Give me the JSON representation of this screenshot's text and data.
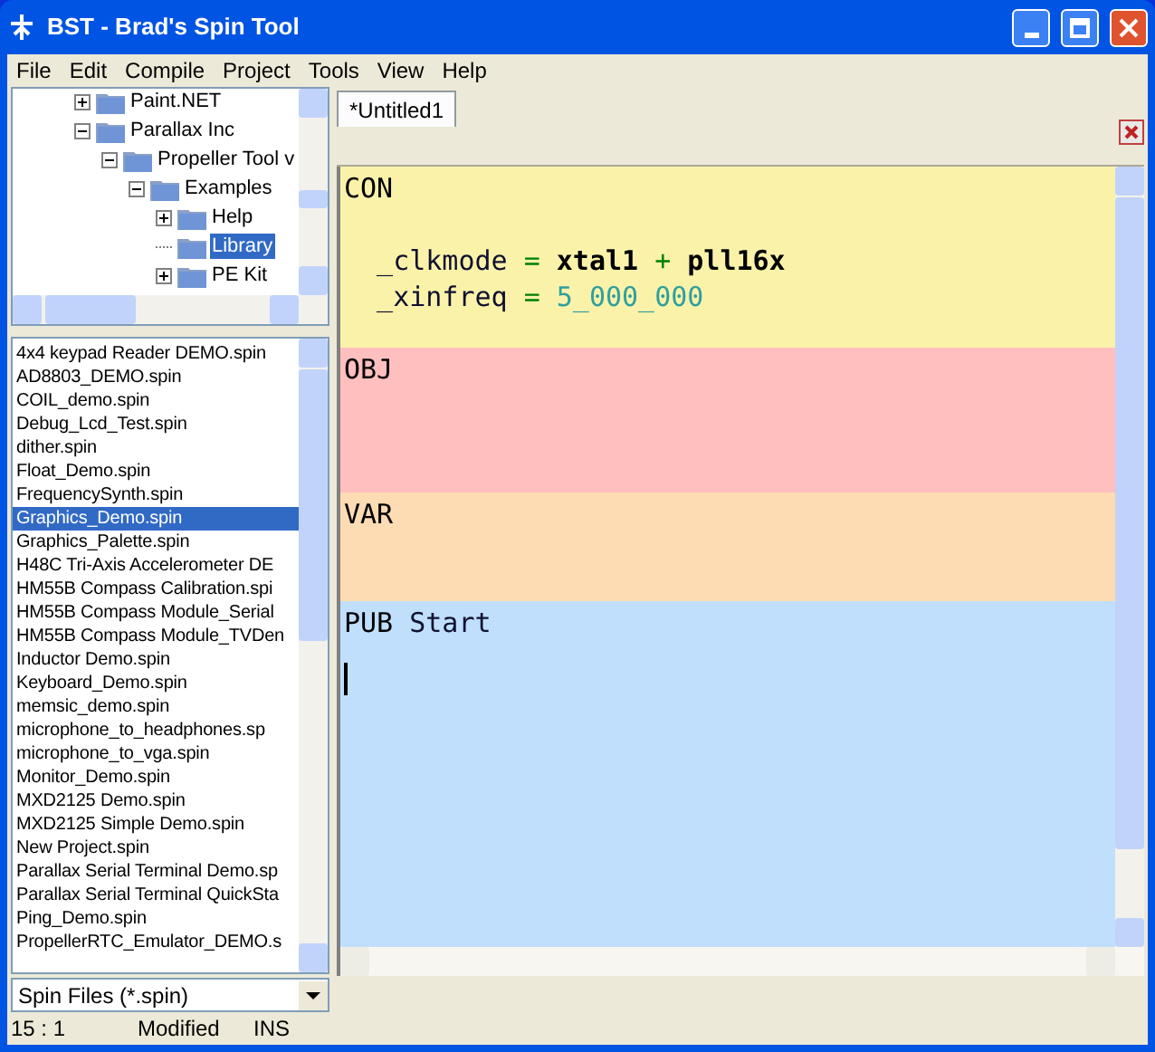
{
  "window": {
    "title": "BST - Brad's Spin Tool"
  },
  "menu": [
    "File",
    "Edit",
    "Compile",
    "Project",
    "Tools",
    "View",
    "Help"
  ],
  "tree": [
    {
      "label": "Paint.NET",
      "kind": "collapsed",
      "selected": false
    },
    {
      "label": "Parallax Inc",
      "kind": "expanded",
      "selected": false,
      "children": [
        {
          "label": "Propeller Tool v",
          "kind": "expanded",
          "selected": false,
          "children": [
            {
              "label": "Examples",
              "kind": "expanded",
              "selected": false,
              "children": [
                {
                  "label": "Help",
                  "kind": "collapsed",
                  "selected": false
                },
                {
                  "label": "Library",
                  "kind": "leaf",
                  "selected": true
                },
                {
                  "label": "PE Kit",
                  "kind": "collapsed",
                  "selected": false
                }
              ]
            }
          ]
        }
      ]
    }
  ],
  "files": [
    {
      "name": "4x4 keypad Reader DEMO.spin",
      "selected": false
    },
    {
      "name": "AD8803_DEMO.spin",
      "selected": false
    },
    {
      "name": "COIL_demo.spin",
      "selected": false
    },
    {
      "name": "Debug_Lcd_Test.spin",
      "selected": false
    },
    {
      "name": "dither.spin",
      "selected": false
    },
    {
      "name": "Float_Demo.spin",
      "selected": false
    },
    {
      "name": "FrequencySynth.spin",
      "selected": false
    },
    {
      "name": "Graphics_Demo.spin",
      "selected": true
    },
    {
      "name": "Graphics_Palette.spin",
      "selected": false
    },
    {
      "name": "H48C Tri-Axis Accelerometer DE",
      "selected": false
    },
    {
      "name": "HM55B Compass Calibration.spi",
      "selected": false
    },
    {
      "name": "HM55B Compass Module_Serial",
      "selected": false
    },
    {
      "name": "HM55B Compass Module_TVDen",
      "selected": false
    },
    {
      "name": "Inductor Demo.spin",
      "selected": false
    },
    {
      "name": "Keyboard_Demo.spin",
      "selected": false
    },
    {
      "name": "memsic_demo.spin",
      "selected": false
    },
    {
      "name": "microphone_to_headphones.sp",
      "selected": false
    },
    {
      "name": "microphone_to_vga.spin",
      "selected": false
    },
    {
      "name": "Monitor_Demo.spin",
      "selected": false
    },
    {
      "name": "MXD2125 Demo.spin",
      "selected": false
    },
    {
      "name": "MXD2125 Simple Demo.spin",
      "selected": false
    },
    {
      "name": "New Project.spin",
      "selected": false
    },
    {
      "name": "Parallax Serial Terminal Demo.sp",
      "selected": false
    },
    {
      "name": "Parallax Serial Terminal QuickSta",
      "selected": false
    },
    {
      "name": "Ping_Demo.spin",
      "selected": false
    },
    {
      "name": "PropellerRTC_Emulator_DEMO.s",
      "selected": false
    }
  ],
  "filter": {
    "value": "Spin Files (*.spin)"
  },
  "tabs": [
    {
      "label": "*Untitled1",
      "selected": true
    }
  ],
  "sections": [
    {
      "kind": "con",
      "caret": false,
      "lines": [
        [
          {
            "kind": "block",
            "text": "CON"
          }
        ],
        [
          {
            "kind": "ident",
            "text": "  _clkmode"
          },
          {
            "kind": "op",
            "text": " = "
          },
          {
            "kind": "const",
            "text": "xtal1"
          },
          {
            "kind": "op",
            "text": " + "
          },
          {
            "kind": "const",
            "text": "pll16x"
          }
        ],
        [
          {
            "kind": "ident",
            "text": "  _xinfreq"
          },
          {
            "kind": "op",
            "text": " = "
          },
          {
            "kind": "number",
            "text": "5_000_000"
          }
        ]
      ]
    },
    {
      "kind": "obj",
      "caret": false,
      "lines": [
        [
          {
            "kind": "block",
            "text": "OBJ"
          }
        ]
      ]
    },
    {
      "kind": "var",
      "caret": false,
      "lines": [
        [
          {
            "kind": "block",
            "text": "VAR"
          }
        ]
      ]
    },
    {
      "kind": "pub",
      "caret": true,
      "lines": [
        [
          {
            "kind": "block",
            "text": "PUB"
          },
          {
            "kind": "ident",
            "text": " Start"
          }
        ]
      ]
    }
  ],
  "status_bar": {
    "position": "15 : 1",
    "modified": "Modified",
    "mode": "INS"
  }
}
